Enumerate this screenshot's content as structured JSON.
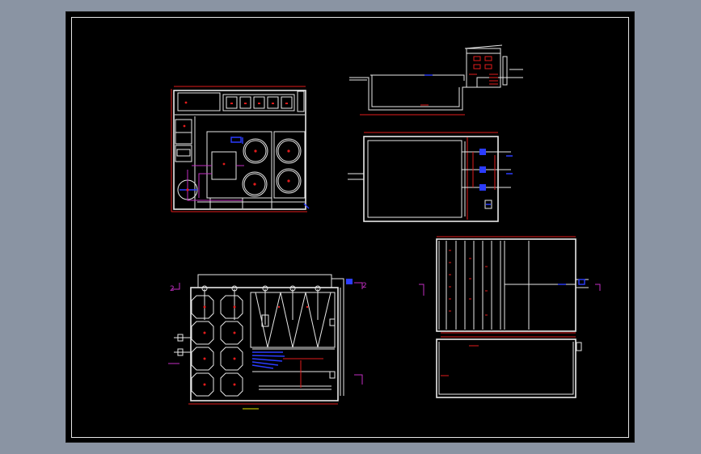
{
  "drawing": {
    "background_color": "#000000",
    "viewport_color": "#8a94a3",
    "line_colors": {
      "outline": "#e8e8e8",
      "dimension": "#e21b1b",
      "pipe": "#2b3cff",
      "flow": "#c22ec2"
    },
    "views": [
      "plan-view-top-left",
      "section-view-top-right",
      "plan-view-middle-right",
      "plan-view-bottom-left",
      "plan-view-bottom-right",
      "section-view-bottom-right"
    ],
    "labels": {
      "section_mark_left": "2",
      "section_mark_right": "2"
    }
  }
}
